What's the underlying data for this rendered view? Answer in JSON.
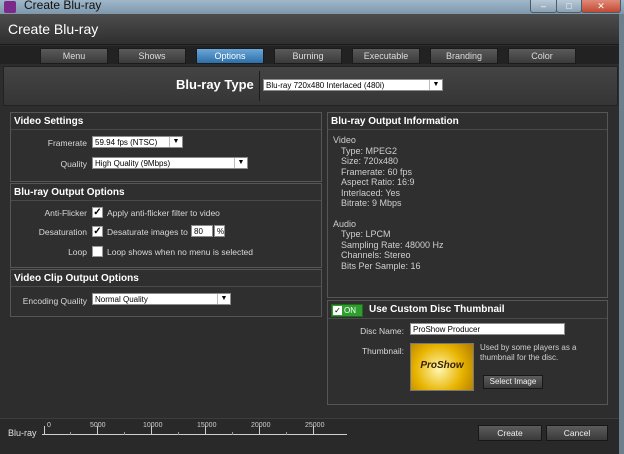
{
  "window": {
    "title": "Create Blu-ray",
    "min_icon": "minimize-icon",
    "max_icon": "maximize-icon",
    "close_icon": "close-icon"
  },
  "dialog": {
    "title": "Create Blu-ray"
  },
  "tabs": [
    "Menu",
    "Shows",
    "Options",
    "Burning",
    "Executable",
    "Branding",
    "Color"
  ],
  "active_tab": "Options",
  "bluray_type": {
    "label": "Blu-ray Type",
    "value": "Blu-ray 720x480 Interlaced (480i)"
  },
  "video_settings": {
    "title": "Video Settings",
    "framerate_label": "Framerate",
    "framerate_value": "59.94 fps (NTSC)",
    "quality_label": "Quality",
    "quality_value": "High Quality (9Mbps)"
  },
  "output_options": {
    "title": "Blu-ray Output Options",
    "antiflicker_label": "Anti-Flicker",
    "antiflicker_checked": true,
    "antiflicker_text": "Apply anti-flicker filter to video",
    "desaturation_label": "Desaturation",
    "desaturation_checked": true,
    "desaturation_text": "Desaturate images to",
    "desaturation_value": "80",
    "desaturation_unit": "%",
    "loop_label": "Loop",
    "loop_checked": false,
    "loop_text": "Loop shows when no menu is selected"
  },
  "clip_options": {
    "title": "Video Clip Output Options",
    "encoding_label": "Encoding Quality",
    "encoding_value": "Normal Quality"
  },
  "output_info": {
    "title": "Blu-ray Output Information",
    "video_heading": "Video",
    "video": [
      "Type: MPEG2",
      "Size: 720x480",
      "Framerate: 60 fps",
      "Aspect Ratio: 16:9",
      "Interlaced: Yes",
      "Bitrate: 9 Mbps"
    ],
    "audio_heading": "Audio",
    "audio": [
      "Type: LPCM",
      "Sampling Rate: 48000 Hz",
      "Channels: Stereo",
      "Bits Per Sample: 16"
    ]
  },
  "thumbnail": {
    "toggle_label": "ON",
    "title": "Use Custom Disc Thumbnail",
    "disc_name_label": "Disc Name:",
    "disc_name_value": "ProShow Producer",
    "thumbnail_label": "Thumbnail:",
    "thumbnail_text": "ProShow",
    "note": "Used by some players as a thumbnail for the disc.",
    "select_button": "Select Image"
  },
  "footer": {
    "capacity_label": "Blu-ray",
    "scale": [
      "0",
      "5000",
      "10000",
      "15000",
      "20000",
      "25000"
    ],
    "create_button": "Create",
    "cancel_button": "Cancel"
  },
  "colors": {
    "active_tab": "#3a7fc0",
    "toggle_on": "#2f9e2f",
    "thumbnail_gold": "#e8b400"
  }
}
